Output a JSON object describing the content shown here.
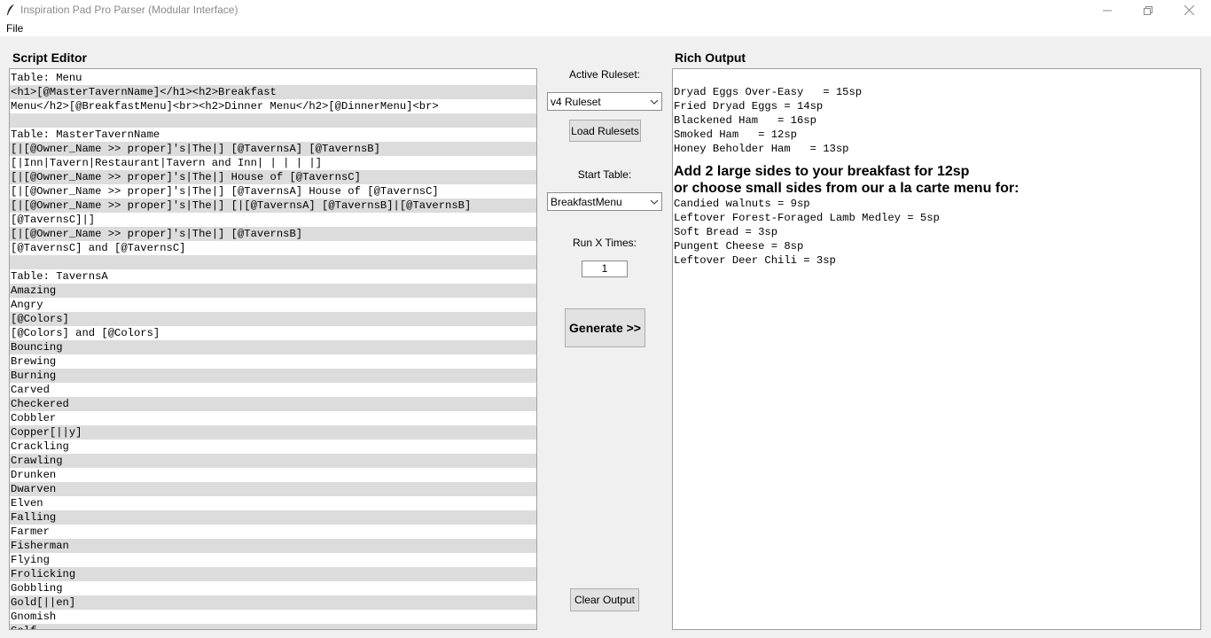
{
  "window": {
    "title": "Inspiration Pad Pro Parser (Modular Interface)"
  },
  "menu": {
    "file_label": "File"
  },
  "script_editor": {
    "heading": "Script Editor",
    "lines": [
      "Table: Menu",
      "<h1>[@MasterTavernName]</h1><h2>Breakfast",
      "Menu</h2>[@BreakfastMenu]<br><h2>Dinner Menu</h2>[@DinnerMenu]<br>",
      "",
      "Table: MasterTavernName",
      "[|[@Owner_Name >> proper]'s|The|] [@TavernsA] [@TavernsB]",
      "[|Inn|Tavern|Restaurant|Tavern and Inn| | | | |]",
      "[|[@Owner_Name >> proper]'s|The|] House of [@TavernsC]",
      "[|[@Owner_Name >> proper]'s|The|] [@TavernsA] House of [@TavernsC]",
      "[|[@Owner_Name >> proper]'s|The|] [|[@TavernsA] [@TavernsB]|[@TavernsB]",
      "[@TavernsC]|]",
      "[|[@Owner_Name >> proper]'s|The|] [@TavernsB]",
      "[@TavernsC] and [@TavernsC]",
      "",
      "Table: TavernsA",
      "Amazing",
      "Angry",
      "[@Colors]",
      "[@Colors] and [@Colors]",
      "Bouncing",
      "Brewing",
      "Burning",
      "Carved",
      "Checkered",
      "Cobbler",
      "Copper[||y]",
      "Crackling",
      "Crawling",
      "Drunken",
      "Dwarven",
      "Elven",
      "Falling",
      "Farmer",
      "Fisherman",
      "Flying",
      "Frolicking",
      "Gobbling",
      "Gold[||en]",
      "Gnomish",
      "Golf"
    ]
  },
  "controls": {
    "ruleset_label": "Active Ruleset:",
    "ruleset_value": "v4 Ruleset",
    "load_rulesets_label": "Load Rulesets",
    "start_table_label": "Start Table:",
    "start_table_value": "BreakfastMenu",
    "run_x_label": "Run X Times:",
    "run_x_value": "1",
    "generate_label": "Generate >>",
    "clear_output_label": "Clear Output"
  },
  "output": {
    "heading": "Rich Output",
    "items_top": [
      "Dryad Eggs Over-Easy   = 15sp",
      "Fried Dryad Eggs = 14sp",
      "Blackened Ham   = 16sp",
      "Smoked Ham   = 12sp",
      "Honey Beholder Ham   = 13sp"
    ],
    "subheading_1": "Add 2 large sides to your breakfast for 12sp",
    "subheading_2": "or choose small sides from our a la carte menu for:",
    "items_bottom": [
      "Candied walnuts = 9sp",
      "Leftover Forest-Foraged Lamb Medley = 5sp",
      "Soft Bread = 3sp",
      "Pungent Cheese = 8sp",
      "Leftover Deer Chili = 3sp"
    ]
  },
  "colors": {
    "window_bg": "#f0f0f0",
    "editor_line_shade": "#dcdcdc",
    "button_bg": "#e1e1e1"
  },
  "icons": {
    "app": "feather-icon",
    "minimize": "minimize-icon",
    "maximize": "restore-icon",
    "close": "close-icon",
    "dropdown": "chevron-down-icon"
  }
}
